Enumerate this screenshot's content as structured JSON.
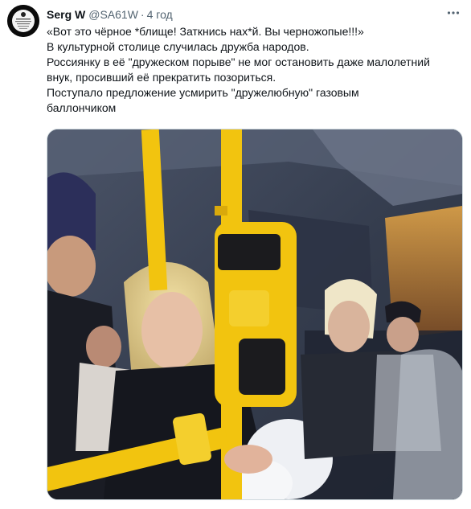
{
  "tweet": {
    "author_name": "Serg W",
    "author_handle": "@SA61W",
    "separator": "·",
    "time": "4 год",
    "text_lines": [
      "«Вот это чёрное *блище! Заткнись нах*й. Вы черножопые!!!»",
      "В культурной столице случилась дружба народов.",
      "Россиянку в её \"дружеском порыве\" не мог остановить даже малолетний",
      "внук, просивший её прекратить позориться.",
      "Поступало предложение усмирить \"дружелюбную\" газовым",
      "баллончиком"
    ],
    "media": {
      "description_icon": "video-frame",
      "colors": {
        "rail": "#f2c40f",
        "bus_interior": "#3a4252",
        "window": "#c98a3a"
      }
    }
  },
  "icons": {
    "more": "more-horizontal-icon",
    "avatar": "profile-avatar"
  }
}
